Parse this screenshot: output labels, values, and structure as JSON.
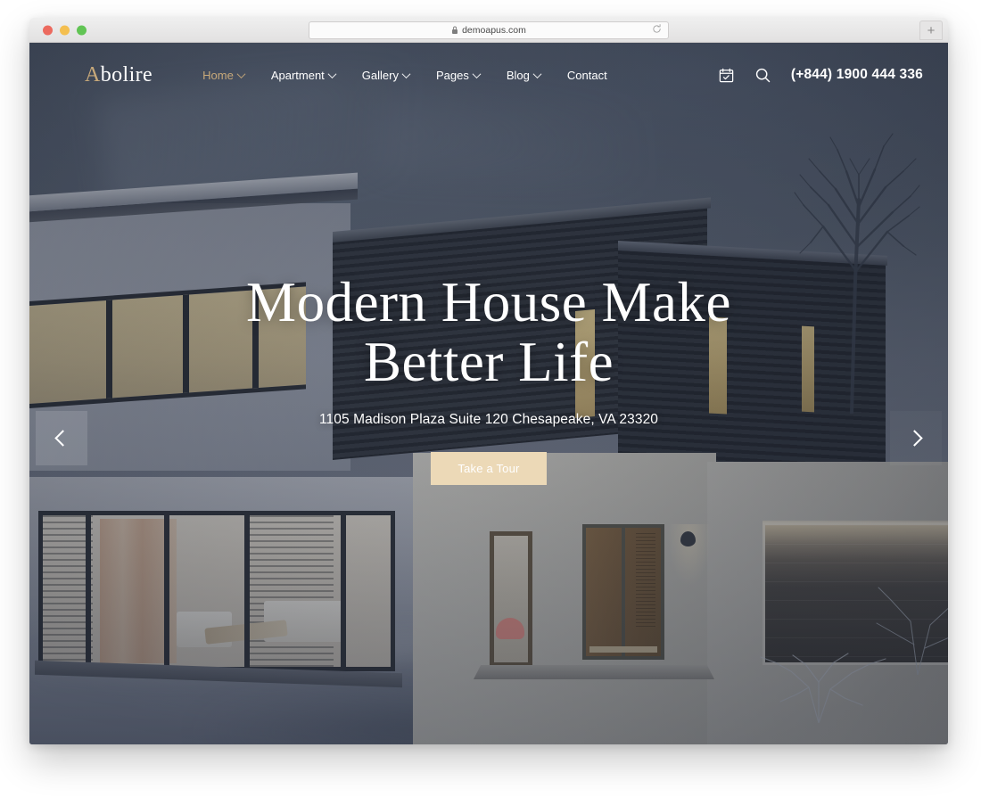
{
  "browser": {
    "url": "demoapus.com",
    "lock_icon": "lock-icon",
    "reload_icon": "reload-icon",
    "new_tab_label": "+",
    "traffic_lights": [
      "close-red",
      "minimize-yellow",
      "maximize-green"
    ]
  },
  "site": {
    "logo_first_letter": "A",
    "logo_rest": "bolire",
    "nav": [
      {
        "label": "Home",
        "has_caret": true,
        "active": true
      },
      {
        "label": "Apartment",
        "has_caret": true,
        "active": false
      },
      {
        "label": "Gallery",
        "has_caret": true,
        "active": false
      },
      {
        "label": "Pages",
        "has_caret": true,
        "active": false
      },
      {
        "label": "Blog",
        "has_caret": true,
        "active": false
      },
      {
        "label": "Contact",
        "has_caret": false,
        "active": false
      }
    ],
    "header_icons": [
      "calendar-check-icon",
      "search-icon"
    ],
    "phone": "(+844) 1900 444 336"
  },
  "hero": {
    "title_line1": "Modern House Make",
    "title_line2": "Better Life",
    "subtitle": "1105 Madison Plaza Suite 120 Chesapeake, VA 23320",
    "cta_label": "Take a Tour",
    "prev_icon": "chevron-left-icon",
    "next_icon": "chevron-right-icon"
  },
  "colors": {
    "accent_gold": "#c8a97a",
    "cta_background": "#ecd9b7",
    "text_on_hero": "#ffffff",
    "sky": "#5b6473",
    "dark_siding": "#2d323b"
  }
}
